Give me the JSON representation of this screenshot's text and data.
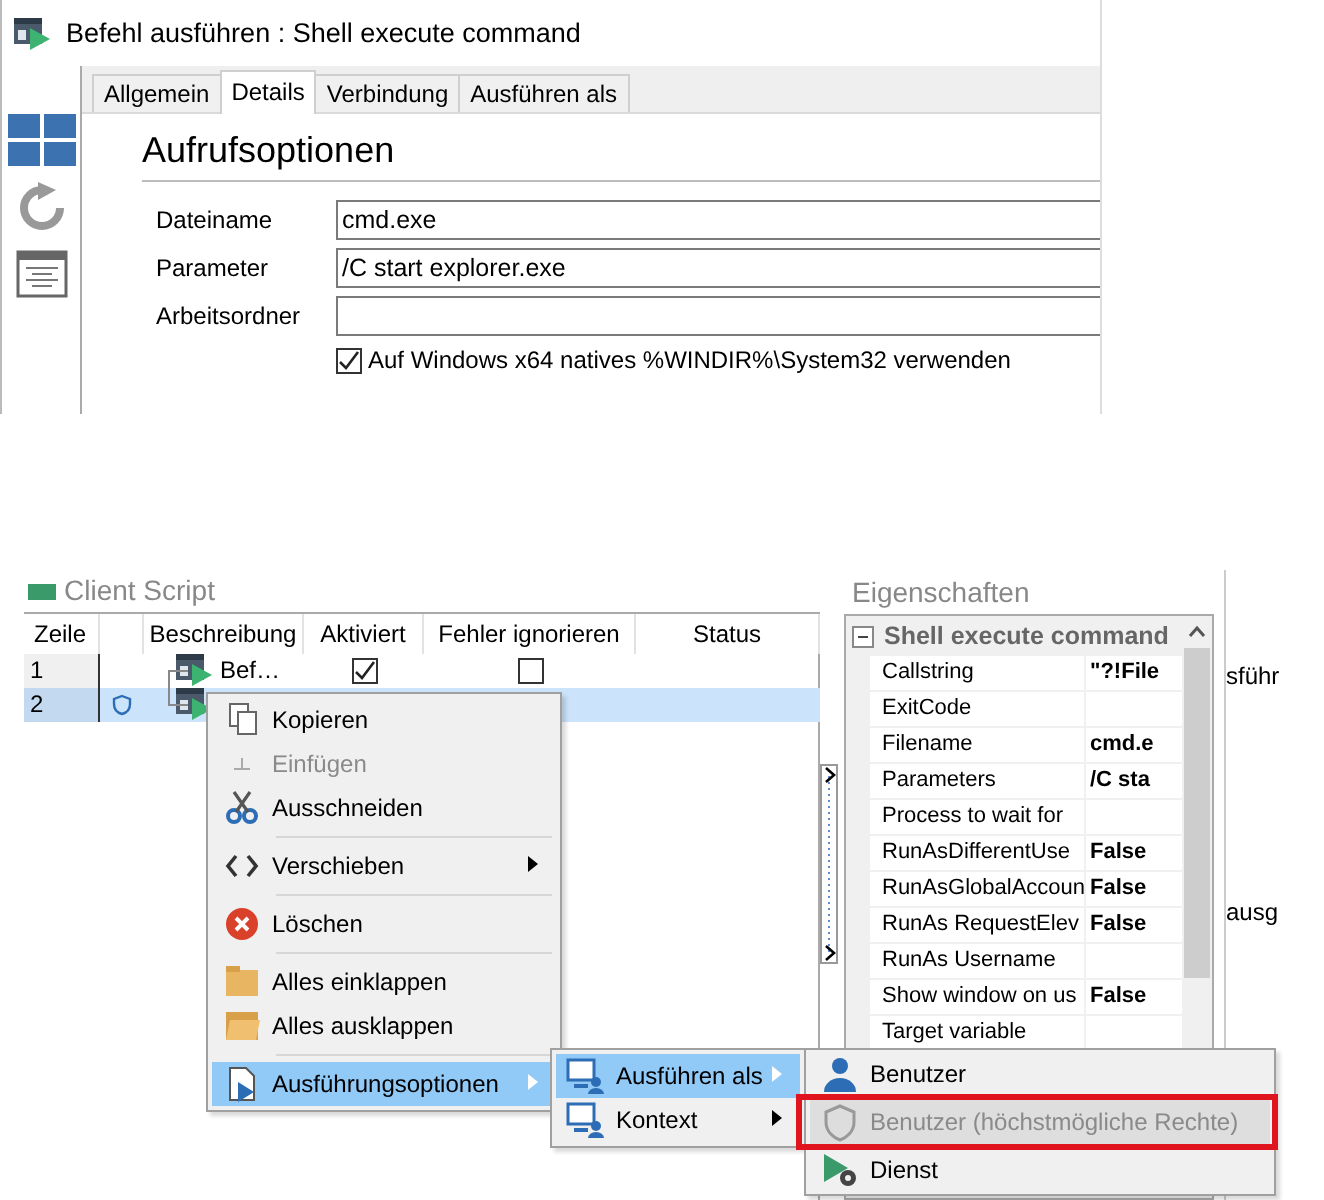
{
  "dialog": {
    "title": "Befehl ausführen : Shell execute command",
    "tabs": [
      {
        "label": "Allgemein",
        "selected": false
      },
      {
        "label": "Details",
        "selected": true
      },
      {
        "label": "Verbindung",
        "selected": false
      },
      {
        "label": "Ausführen als",
        "selected": false
      }
    ],
    "section_title": "Aufrufsoptionen",
    "fields": [
      {
        "label": "Dateiname",
        "value": "cmd.exe"
      },
      {
        "label": "Parameter",
        "value": "/C start explorer.exe"
      },
      {
        "label": "Arbeitsordner"
      }
    ],
    "checkbox": {
      "label": "Auf Windows x64 natives %WINDIR%\\System32 verwenden",
      "checked": true
    }
  },
  "script_panel": {
    "title": "Client Script",
    "columns": [
      "Zeile",
      "Beschreibung",
      "Aktiviert",
      "Fehler ignorieren",
      "Status"
    ],
    "rows": [
      {
        "line": "1",
        "description": "Bef…",
        "enabled": true,
        "ignore_errors": false,
        "elevated": false,
        "selected": false
      },
      {
        "line": "2",
        "elevated": true,
        "selected": true
      }
    ]
  },
  "properties": {
    "title": "Eigenschaften",
    "category": "Shell execute command",
    "expanded": true,
    "rows": [
      {
        "name": "Callstring",
        "value": "\"?!File"
      },
      {
        "name": "ExitCode"
      },
      {
        "name": "Filename",
        "value": "cmd.e"
      },
      {
        "name": "Parameters",
        "value": "/C sta"
      },
      {
        "name": "Process to wait for"
      },
      {
        "name": "RunAsDifferentUse",
        "value": "False"
      },
      {
        "name": "RunAsGlobalAccoun",
        "value": "False"
      },
      {
        "name": "RunAs RequestElev",
        "value": "False"
      },
      {
        "name": "RunAs Username"
      },
      {
        "name": "Show window on us",
        "value": "False"
      },
      {
        "name": "Target variable"
      }
    ]
  },
  "background_fragments": [
    "sführ",
    "ausg"
  ],
  "context_menu": [
    {
      "label": "Kopieren",
      "disabled": false,
      "selected": false,
      "separator_before": false,
      "submenu": false
    },
    {
      "label": "Einfügen",
      "disabled": true,
      "selected": false,
      "separator_before": false,
      "submenu": false
    },
    {
      "label": "Ausschneiden",
      "disabled": false,
      "selected": false,
      "separator_before": false,
      "submenu": false
    },
    {
      "label": "Verschieben",
      "disabled": false,
      "selected": false,
      "separator_before": true,
      "submenu": true
    },
    {
      "label": "Löschen",
      "disabled": false,
      "selected": false,
      "separator_before": true,
      "submenu": false
    },
    {
      "label": "Alles einklappen",
      "disabled": false,
      "selected": false,
      "separator_before": true,
      "submenu": false
    },
    {
      "label": "Alles ausklappen",
      "disabled": false,
      "selected": false,
      "separator_before": false,
      "submenu": false
    },
    {
      "label": "Ausführungsoptionen",
      "disabled": false,
      "selected": true,
      "separator_before": true,
      "submenu": true
    }
  ],
  "submenu": [
    {
      "label": "Ausführen als",
      "selected": true,
      "submenu": true
    },
    {
      "label": "Kontext",
      "selected": false,
      "submenu": true
    }
  ],
  "run_as_menu": [
    {
      "label": "Benutzer",
      "disabled": false,
      "selected": false,
      "marked": false
    },
    {
      "label": "Benutzer (höchstmögliche Rechte)",
      "disabled": true,
      "selected": true,
      "marked": true
    },
    {
      "label": "Dienst",
      "disabled": false,
      "selected": false,
      "marked": false
    }
  ]
}
